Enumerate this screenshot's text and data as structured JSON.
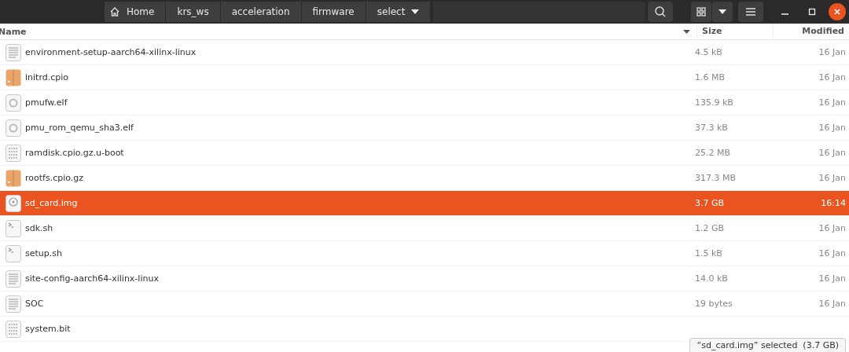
{
  "path_bar": [
    {
      "label": "Home",
      "kind": "home"
    },
    {
      "label": "krs_ws",
      "kind": "folder"
    },
    {
      "label": "acceleration",
      "kind": "folder"
    },
    {
      "label": "firmware",
      "kind": "folder"
    },
    {
      "label": "select",
      "kind": "current"
    }
  ],
  "columns": {
    "name": "Name",
    "size": "Size",
    "modified": "Modified"
  },
  "files": [
    {
      "name": "environment-setup-aarch64-xilinx-linux",
      "size": "4.5 kB",
      "modified": "16 Jan",
      "kind": "text",
      "selected": false
    },
    {
      "name": "initrd.cpio",
      "size": "1.6 MB",
      "modified": "16 Jan",
      "kind": "archive",
      "selected": false
    },
    {
      "name": "pmufw.elf",
      "size": "135.9 kB",
      "modified": "16 Jan",
      "kind": "executable",
      "selected": false
    },
    {
      "name": "pmu_rom_qemu_sha3.elf",
      "size": "37.3 kB",
      "modified": "16 Jan",
      "kind": "executable",
      "selected": false
    },
    {
      "name": "ramdisk.cpio.gz.u-boot",
      "size": "25.2 MB",
      "modified": "16 Jan",
      "kind": "binary",
      "selected": false
    },
    {
      "name": "rootfs.cpio.gz",
      "size": "317.3 MB",
      "modified": "16 Jan",
      "kind": "archive",
      "selected": false
    },
    {
      "name": "sd_card.img",
      "size": "3.7 GB",
      "modified": "16:14",
      "kind": "disk",
      "selected": true
    },
    {
      "name": "sdk.sh",
      "size": "1.2 GB",
      "modified": "16 Jan",
      "kind": "script",
      "selected": false
    },
    {
      "name": "setup.sh",
      "size": "1.5 kB",
      "modified": "16 Jan",
      "kind": "script",
      "selected": false
    },
    {
      "name": "site-config-aarch64-xilinx-linux",
      "size": "14.0 kB",
      "modified": "16 Jan",
      "kind": "text",
      "selected": false
    },
    {
      "name": "SOC",
      "size": "19 bytes",
      "modified": "16 Jan",
      "kind": "text",
      "selected": false
    },
    {
      "name": "system.bit",
      "kind": "binary",
      "selected": false
    }
  ],
  "status": "“sd_card.img” selected  (3.7 GB)"
}
